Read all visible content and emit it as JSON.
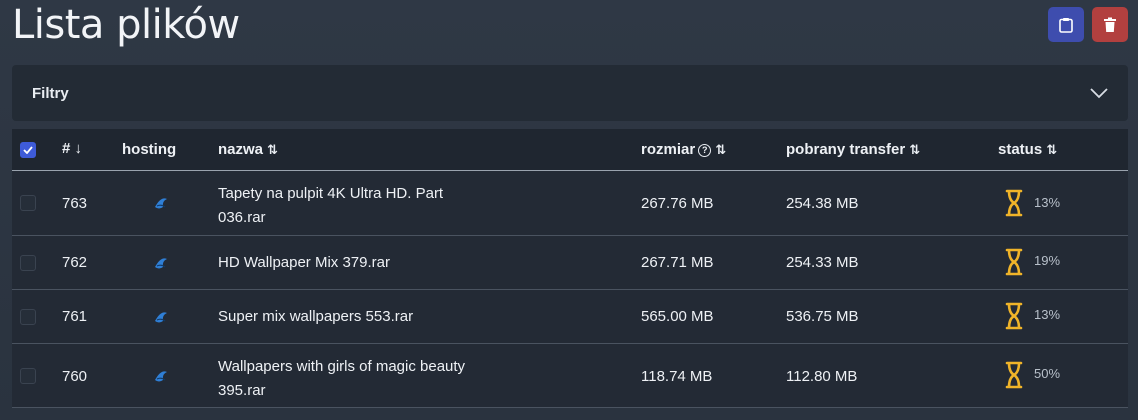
{
  "page": {
    "title": "Lista plików"
  },
  "filters": {
    "label": "Filtry"
  },
  "table": {
    "headers": {
      "index": "#",
      "index_sort": "↓",
      "hosting": "hosting",
      "name": "nazwa",
      "size": "rozmiar",
      "size_help": "?",
      "transfer": "pobrany transfer",
      "status": "status",
      "sort": "⇅"
    },
    "rows": [
      {
        "id": "763",
        "name_line1": "Tapety na pulpit 4K Ultra HD. Part",
        "name_line2": "036.rar",
        "size": "267.76 MB",
        "transfer": "254.38 MB",
        "percent": "13%",
        "progress": 0.13
      },
      {
        "id": "762",
        "name_line1": "HD Wallpaper Mix 379.rar",
        "name_line2": "",
        "size": "267.71 MB",
        "transfer": "254.33 MB",
        "percent": "19%",
        "progress": 0.19
      },
      {
        "id": "761",
        "name_line1": "Super mix wallpapers 553.rar",
        "name_line2": "",
        "size": "565.00 MB",
        "transfer": "536.75 MB",
        "percent": "13%",
        "progress": 0.13
      },
      {
        "id": "760",
        "name_line1": "Wallpapers with girls of magic beauty",
        "name_line2": "395.rar",
        "size": "118.74 MB",
        "transfer": "112.80 MB",
        "percent": "50%",
        "progress": 0.5
      }
    ]
  },
  "colors": {
    "clipboard_button": "#3e4dae",
    "delete_button": "#b2403f",
    "hourglass": "#f0b429",
    "checkbox_checked": "#3e5bd8",
    "hosting_icon": "#2f7fd6"
  },
  "icons": {
    "clipboard_button": "clipboard-icon",
    "delete_button": "trash-icon",
    "filters_toggle": "chevron-down-icon",
    "status": "hourglass-icon",
    "hosting": "hosting-logo-icon",
    "help": "question-circle-icon"
  }
}
